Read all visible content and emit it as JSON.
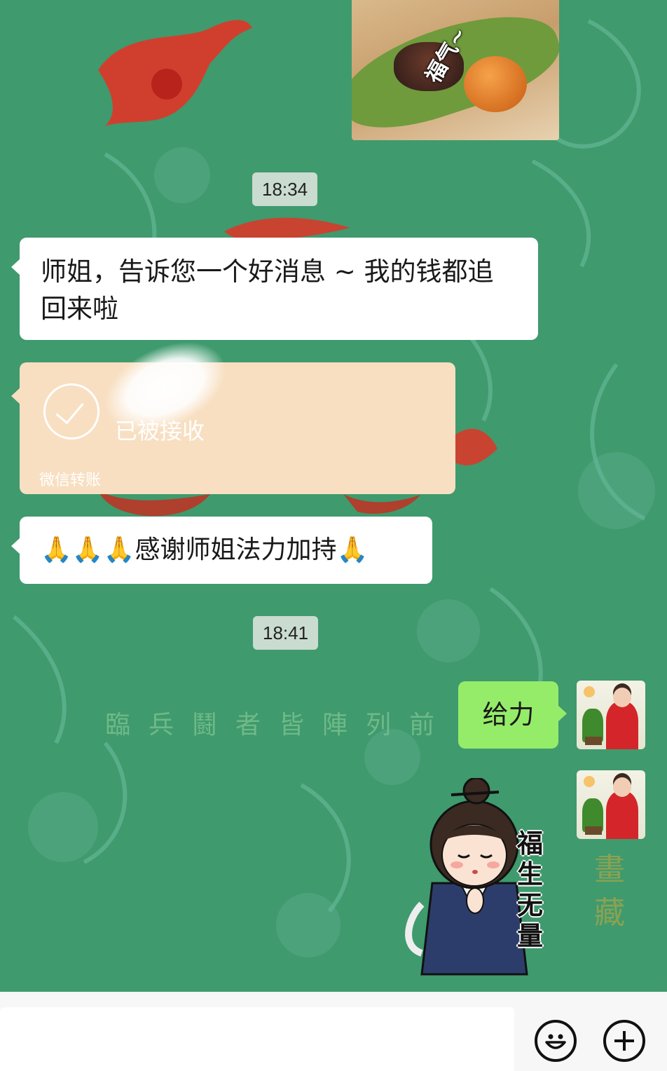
{
  "chat": {
    "messages": [
      {
        "type": "sticker-image",
        "side": "right",
        "caption": "福气~"
      },
      {
        "type": "time",
        "text": "18:34"
      },
      {
        "type": "text",
        "side": "left",
        "text": "师姐，告诉您一个好消息 ~ 我的钱都追回来啦"
      },
      {
        "type": "transfer",
        "side": "left",
        "status": "已被接收",
        "footer": "微信转账"
      },
      {
        "type": "text",
        "side": "left",
        "text": "🙏🙏🙏感谢师姐法力加持🙏"
      },
      {
        "type": "time",
        "text": "18:41"
      },
      {
        "type": "text",
        "side": "right",
        "text": "给力"
      },
      {
        "type": "sticker",
        "side": "right",
        "text": "福生无量"
      }
    ]
  },
  "background": {
    "motto": "臨兵鬪者皆陣列前",
    "vertical": "畫藏"
  },
  "input_bar": {
    "emoji_icon": "emoji-icon",
    "more_icon": "plus-icon"
  },
  "colors": {
    "chat_bg": "#3f9a6e",
    "sent_bubble": "#95ec69",
    "received_bubble": "#ffffff",
    "transfer_bubble": "#f8dfc1"
  }
}
